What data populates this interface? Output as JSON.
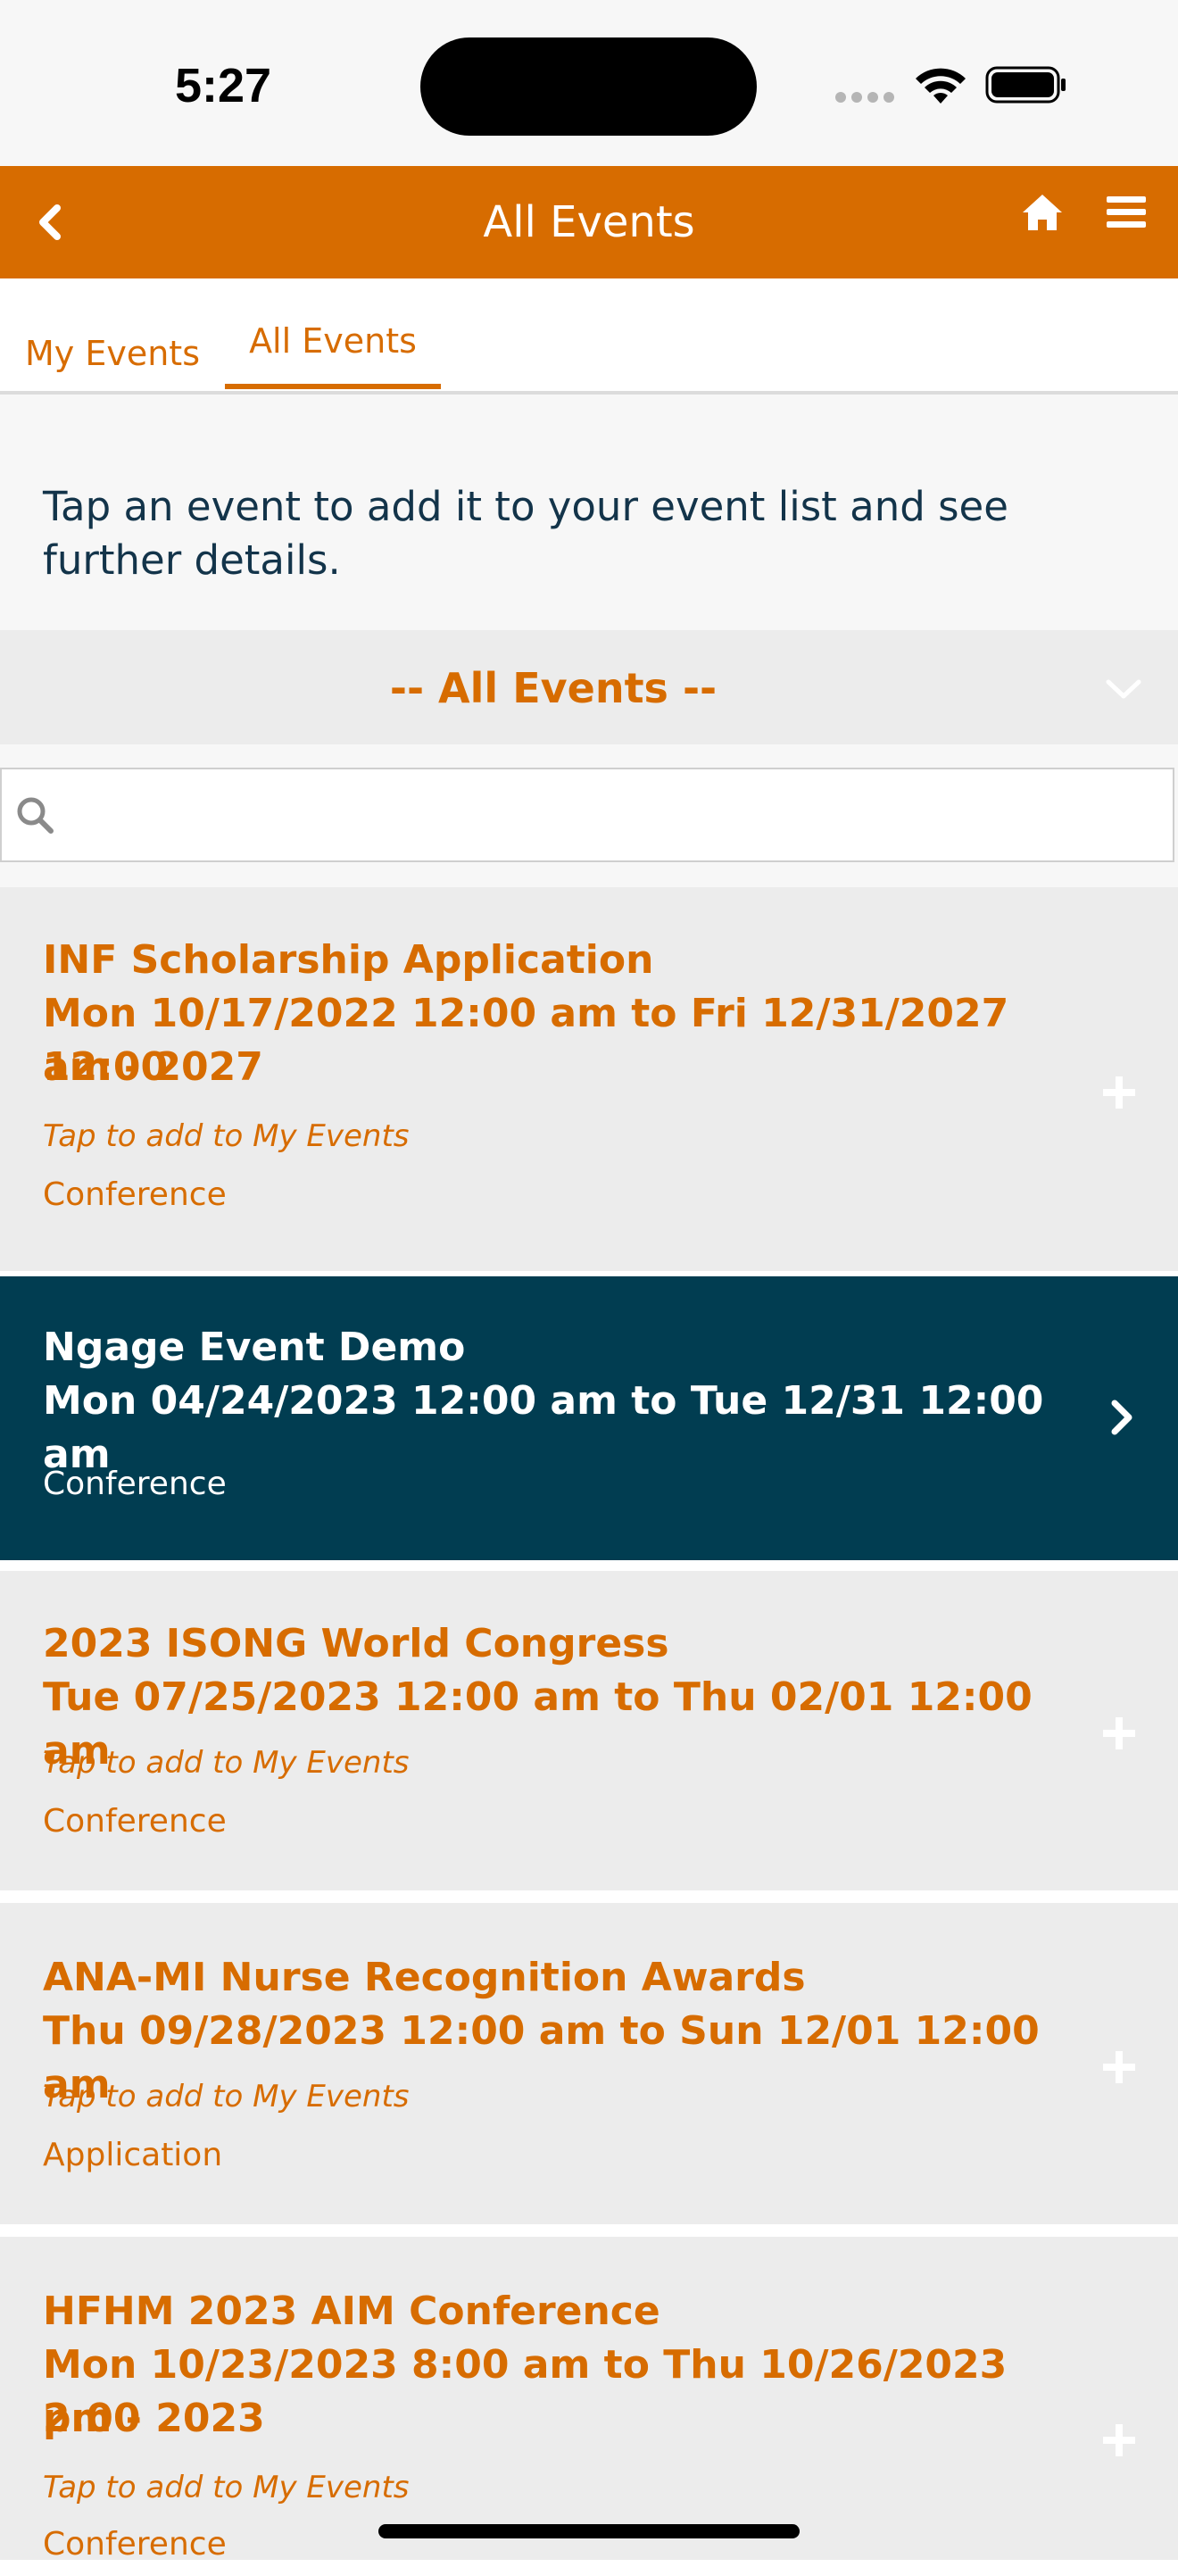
{
  "status_bar": {
    "time": "5:27",
    "icons": [
      "signal-icon",
      "wifi-icon",
      "battery-icon"
    ]
  },
  "nav": {
    "title": "All Events",
    "icons": [
      "back-chevron-icon",
      "home-icon",
      "hamburger-menu-icon"
    ]
  },
  "tabs": [
    {
      "label": "My Events",
      "selected": false
    },
    {
      "label": "All Events",
      "selected": true
    }
  ],
  "intro_text": "Tap an event to add it to your event list and see further details.",
  "filter": {
    "selected_value": "-- All Events --"
  },
  "search": {
    "value": "",
    "placeholder": ""
  },
  "events": [
    {
      "title_line1": "INF Scholarship Application",
      "title_line2": "Mon 10/17/2022 12:00 am to Fri 12/31/2027 12:00",
      "title_line3": "am - 2027",
      "hint": "Tap to add to My Events",
      "type": "Conference",
      "action_icon": "plus-icon",
      "selected": false
    },
    {
      "title_line1": "Ngage Event Demo",
      "title_line2": "Mon 04/24/2023 12:00 am to Tue 12/31 12:00 am",
      "type": "Conference",
      "action_icon": "chevron-right-icon",
      "selected": true
    },
    {
      "title_line1": "2023 ISONG World Congress",
      "title_line2": "Tue 07/25/2023 12:00 am to Thu 02/01 12:00 am",
      "hint": "Tap to add to My Events",
      "type": "Conference",
      "action_icon": "plus-icon",
      "selected": false
    },
    {
      "title_line1": "ANA-MI Nurse Recognition Awards",
      "title_line2": "Thu 09/28/2023 12:00 am to Sun 12/01 12:00 am",
      "hint": "Tap to add to My Events",
      "type": "Application",
      "action_icon": "plus-icon",
      "selected": false
    },
    {
      "title_line1": "HFHM 2023 AIM Conference",
      "title_line2": "Mon 10/23/2023 8:00 am to Thu 10/26/2023 2:00",
      "title_line3": "pm - 2023",
      "hint": "Tap to add to My Events",
      "type": "Conference",
      "action_icon": "plus-icon",
      "selected": false
    }
  ],
  "colors": {
    "brand_orange": "#d76c00",
    "selected_teal": "#013d51",
    "card_gray": "#ececec",
    "intro_text": "#13344a"
  }
}
